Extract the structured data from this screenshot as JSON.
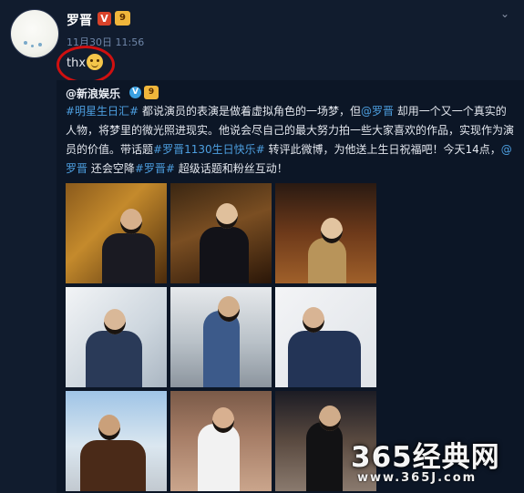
{
  "post": {
    "author": "罗晋",
    "verified_mark": "V",
    "level_badge": "9",
    "timestamp": "11月30日 11:56",
    "text": "thx",
    "emoji": "smile-emoji"
  },
  "repost": {
    "author": "@新浪娱乐",
    "verified_mark": "V",
    "level_badge": "9",
    "segments": [
      {
        "t": "#明星生日汇#",
        "link": true
      },
      {
        "t": " 都说演员的表演是做着虚拟角色的一场梦，但",
        "link": false
      },
      {
        "t": "@罗晋",
        "link": true
      },
      {
        "t": " 却用一个又一个真实的人物，将梦里的微光照进现实。他说会尽自己的最大努力拍一些大家喜欢的作品，实现作为演员的价值。带话题",
        "link": false
      },
      {
        "t": "#罗晋1130生日快乐#",
        "link": true
      },
      {
        "t": " 转评此微博，为他送上生日祝福吧！今天14点，",
        "link": false
      },
      {
        "t": "@罗晋",
        "link": true
      },
      {
        "t": " 还会空降",
        "link": false
      },
      {
        "t": "#罗晋#",
        "link": true
      },
      {
        "t": " 超级话题和粉丝互动！",
        "link": false
      }
    ],
    "photos": [
      {
        "name": "photo-1"
      },
      {
        "name": "photo-2"
      },
      {
        "name": "photo-3"
      },
      {
        "name": "photo-4"
      },
      {
        "name": "photo-5"
      },
      {
        "name": "photo-6"
      },
      {
        "name": "photo-7"
      },
      {
        "name": "photo-8"
      },
      {
        "name": "photo-9"
      }
    ]
  },
  "watermark": {
    "main": "365经典网",
    "url": "www.365J.com"
  },
  "colors": {
    "background": "#111c2e",
    "link": "#4d9fe0",
    "highlight_circle": "#d01010"
  }
}
